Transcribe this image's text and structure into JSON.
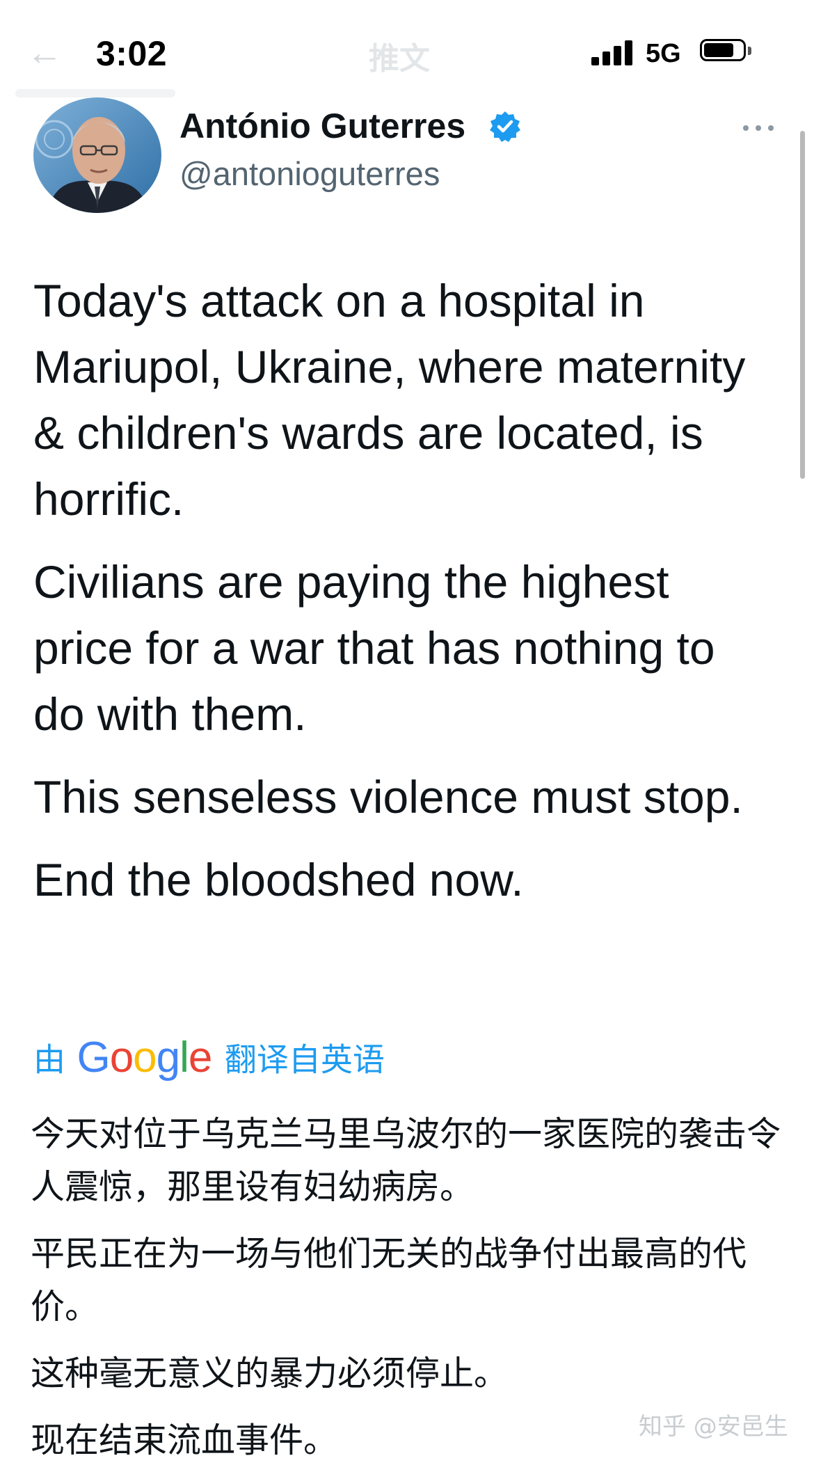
{
  "status_bar": {
    "time": "3:02",
    "network": "5G",
    "back_arrow": "←",
    "page_title": "推文",
    "battery_level": 0.75
  },
  "tweet": {
    "author_name": "António Guterres",
    "author_handle": "@antonioguterres",
    "verified": true,
    "paragraphs": [
      "Today's attack on a hospital in Mariupol, Ukraine, where maternity & children's wards are located, is horrific.",
      "Civilians are paying the highest price for a war that has nothing to do with them.",
      "This senseless violence must stop.",
      "End the bloodshed now."
    ]
  },
  "translation": {
    "prefix": "由",
    "provider": "Google",
    "suffix": "翻译自英语",
    "paragraphs": [
      "今天对位于乌克兰马里乌波尔的一家医院的袭击令人震惊，那里设有妇幼病房。",
      "平民正在为一场与他们无关的战争付出最高的代价。",
      "这种毫无意义的暴力必须停止。",
      "现在结束流血事件。"
    ]
  },
  "watermark": "知乎 @安邑生",
  "colors": {
    "accent": "#1d9bf0",
    "secondary_text": "#536471",
    "primary_text": "#0f1419",
    "google_blue": "#4285f4",
    "google_red": "#ea4335",
    "google_yellow": "#fbbc05",
    "google_green": "#34a853"
  },
  "icons": [
    "back-arrow-icon",
    "signal-icon",
    "battery-icon",
    "verified-badge-icon",
    "more-icon"
  ]
}
